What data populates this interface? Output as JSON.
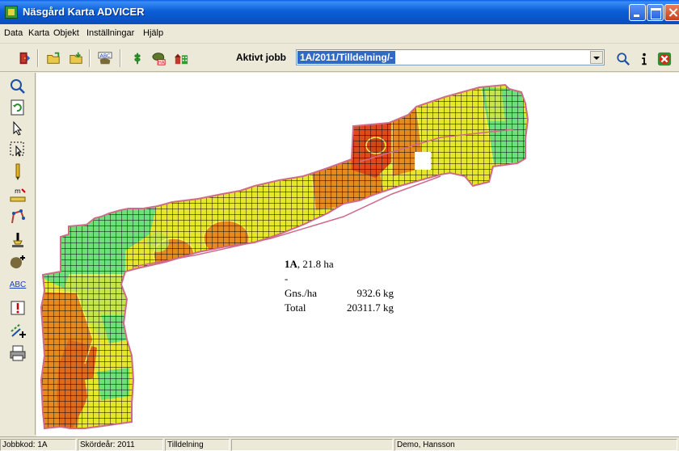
{
  "window": {
    "title": "Näsgård Karta ADVICER"
  },
  "menu": [
    "Data",
    "Karta",
    "Objekt",
    "Inställningar",
    "Hjälp"
  ],
  "toolbar": {
    "job_label": "Aktivt jobb",
    "job_value": "1A/2011/Tilldelning/-",
    "abc": "ABC",
    "ha": "HA"
  },
  "left_toolbar": {
    "abc": "ABC"
  },
  "info": {
    "field": "1A",
    "area": ", 21.8 ha",
    "dash": "-",
    "avg_label": "Gns./ha",
    "avg_value": "932.6 kg",
    "total_label": "Total",
    "total_value": "20311.7 kg"
  },
  "status": {
    "jobbkod": "Jobbkod: 1A",
    "skordear": "Skördeår: 2011",
    "type": "Tilldelning",
    "empty": "",
    "user": "Demo, Hansson"
  },
  "colors": {
    "high": "#e04a1a",
    "mid_high": "#e58a1c",
    "mid": "#e6e62a",
    "low_mid": "#c5e64a",
    "low": "#6ee07a",
    "title_bar": "#0a55c8"
  }
}
